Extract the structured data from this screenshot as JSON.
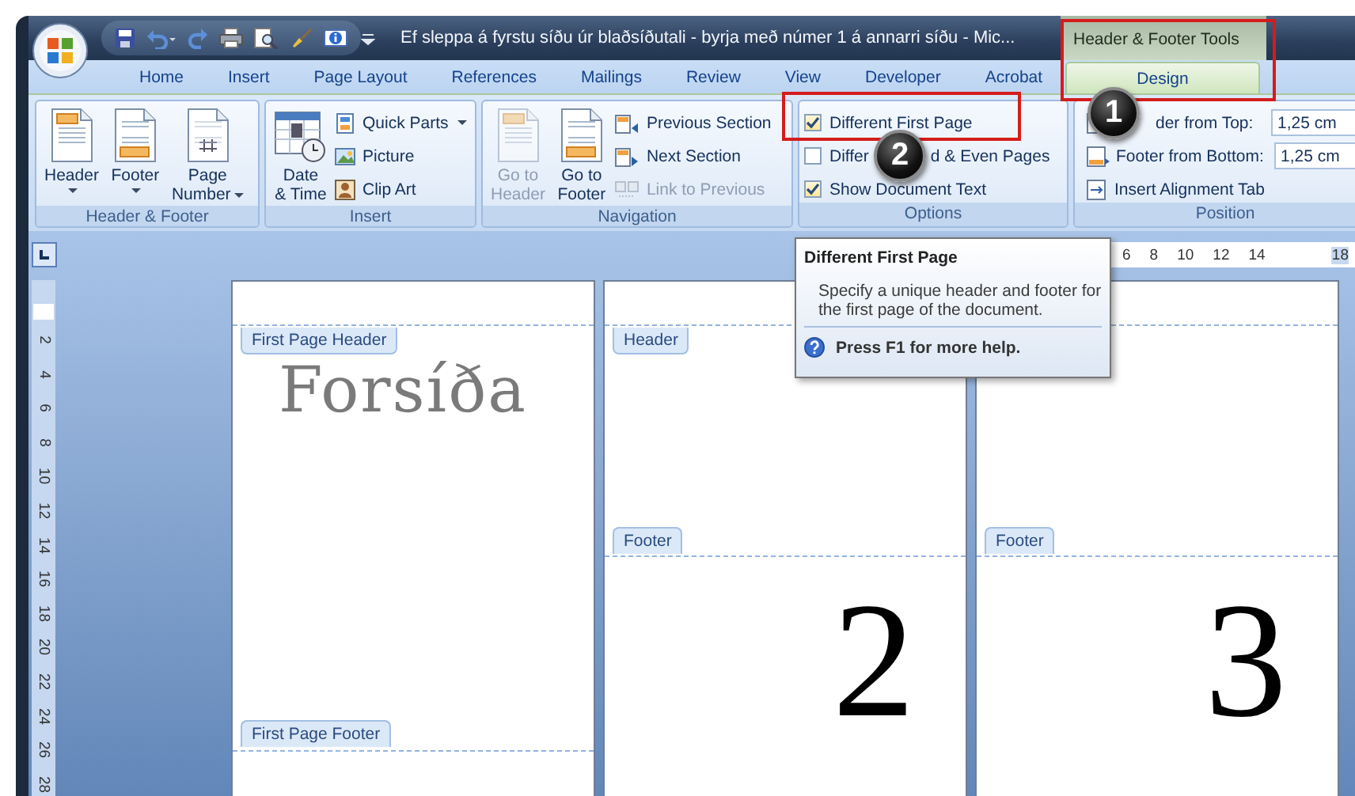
{
  "window": {
    "title": "Ef sleppa á fyrstu síðu úr blaðsíðutali - byrja með númer 1 á annarri síðu - Mic...",
    "contextual_title": "Header & Footer Tools"
  },
  "tabs": [
    {
      "label": "Home",
      "selected": false,
      "kind": "standard"
    },
    {
      "label": "Insert",
      "selected": false,
      "kind": "standard"
    },
    {
      "label": "Page Layout",
      "selected": false,
      "kind": "standard"
    },
    {
      "label": "References",
      "selected": false,
      "kind": "standard"
    },
    {
      "label": "Mailings",
      "selected": false,
      "kind": "standard"
    },
    {
      "label": "Review",
      "selected": false,
      "kind": "standard"
    },
    {
      "label": "View",
      "selected": false,
      "kind": "standard"
    },
    {
      "label": "Developer",
      "selected": false,
      "kind": "standard"
    },
    {
      "label": "Acrobat",
      "selected": false,
      "kind": "standard"
    },
    {
      "label": "Design",
      "selected": true,
      "kind": "contextual"
    }
  ],
  "groups": [
    {
      "kind": "buttons",
      "label": "Header & Footer",
      "large_buttons": [
        {
          "lines": [
            "Header"
          ],
          "dropdown": true,
          "disabled": false
        },
        {
          "lines": [
            "Footer"
          ],
          "dropdown": true,
          "disabled": false
        },
        {
          "lines": [
            "Page",
            "Number"
          ],
          "dropdown": true,
          "disabled": false
        }
      ]
    },
    {
      "kind": "buttons",
      "label": "Insert",
      "large_buttons": [
        {
          "lines": [
            "Date",
            "& Time"
          ],
          "dropdown": false,
          "disabled": false
        }
      ],
      "small_buttons": [
        {
          "label": "Quick Parts",
          "dropdown": true,
          "disabled": false
        },
        {
          "label": "Picture",
          "dropdown": false,
          "disabled": false
        },
        {
          "label": "Clip Art",
          "dropdown": false,
          "disabled": false
        }
      ]
    },
    {
      "kind": "buttons",
      "label": "Navigation",
      "large_buttons": [
        {
          "lines": [
            "Go to",
            "Header"
          ],
          "dropdown": false,
          "disabled": true
        },
        {
          "lines": [
            "Go to",
            "Footer"
          ],
          "dropdown": false,
          "disabled": false
        }
      ],
      "small_buttons": [
        {
          "label": "Previous Section",
          "dropdown": false,
          "disabled": false
        },
        {
          "label": "Next Section",
          "dropdown": false,
          "disabled": false
        },
        {
          "label": "Link to Previous",
          "dropdown": false,
          "disabled": true
        }
      ]
    },
    {
      "kind": "options",
      "label": "Options",
      "options": [
        {
          "label_parts": [
            "Different First Page"
          ],
          "checked": true
        },
        {
          "label_parts": [
            "Differ",
            "d & Even Pages"
          ],
          "checked": false
        },
        {
          "label_parts": [
            "Show Document Text"
          ],
          "checked": true
        }
      ]
    },
    {
      "kind": "position",
      "label": "Position",
      "fields": [
        {
          "label": "der from Top:",
          "value": "1,25 cm"
        },
        {
          "label": "Footer from Bottom:",
          "value": "1,25 cm"
        }
      ],
      "small_buttons": [
        {
          "label": "Insert Alignment Tab",
          "dropdown": false,
          "disabled": false
        }
      ]
    }
  ],
  "ruler": {
    "ticks": [
      "6",
      "8",
      "10",
      "12",
      "14",
      "18"
    ]
  },
  "vertical_ruler": {
    "ticks": [
      "2",
      "4",
      "6",
      "8",
      "10",
      "12",
      "14",
      "16",
      "18",
      "20",
      "22",
      "24",
      "26",
      "28"
    ]
  },
  "pages": [
    {
      "kind": "first",
      "header_tag": "First Page Header",
      "body_text": "Forsíða",
      "footer_tag": "First Page Footer"
    },
    {
      "kind": "continuation",
      "header_tag": "Header",
      "footer_tag": "Footer",
      "page_number": "2"
    },
    {
      "kind": "continuation",
      "footer_tag": "Footer",
      "page_number": "3"
    }
  ],
  "tooltip": {
    "title": "Different First Page",
    "body": "Specify a unique header and footer for the first page of the document.",
    "help": "Press F1 for more help."
  },
  "callouts": [
    {
      "number": "1"
    },
    {
      "number": "2"
    }
  ]
}
